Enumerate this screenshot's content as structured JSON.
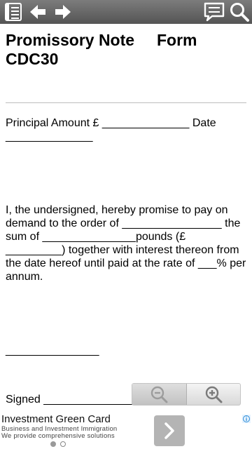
{
  "toolbar": {
    "icons": [
      "document-list-icon",
      "arrow-left-icon",
      "arrow-right-icon",
      "comment-icon",
      "search-icon"
    ]
  },
  "document": {
    "title": "Promissory Note     Form CDC30",
    "principal_line": "Principal Amount £ ______________ Date ______________",
    "promise_paragraph": "I, the undersigned, hereby promise to pay on demand to the order of ________________ the sum of _______________pounds (£ _________) together with interest thereon from the date hereof until paid at the rate of ___% per annum.",
    "blank_line": "_______________",
    "signed_line": "Signed _______________"
  },
  "zoom": {
    "icons": [
      "zoom-out-icon",
      "zoom-in-icon"
    ]
  },
  "ad": {
    "title": "Investment Green Card",
    "line1": "Business and Investment Immigration",
    "line2": "We provide comprehensive solutions",
    "icons": [
      "chevron-right-icon",
      "ad-info-icon"
    ],
    "pager": {
      "count": 2,
      "active": 1
    }
  }
}
